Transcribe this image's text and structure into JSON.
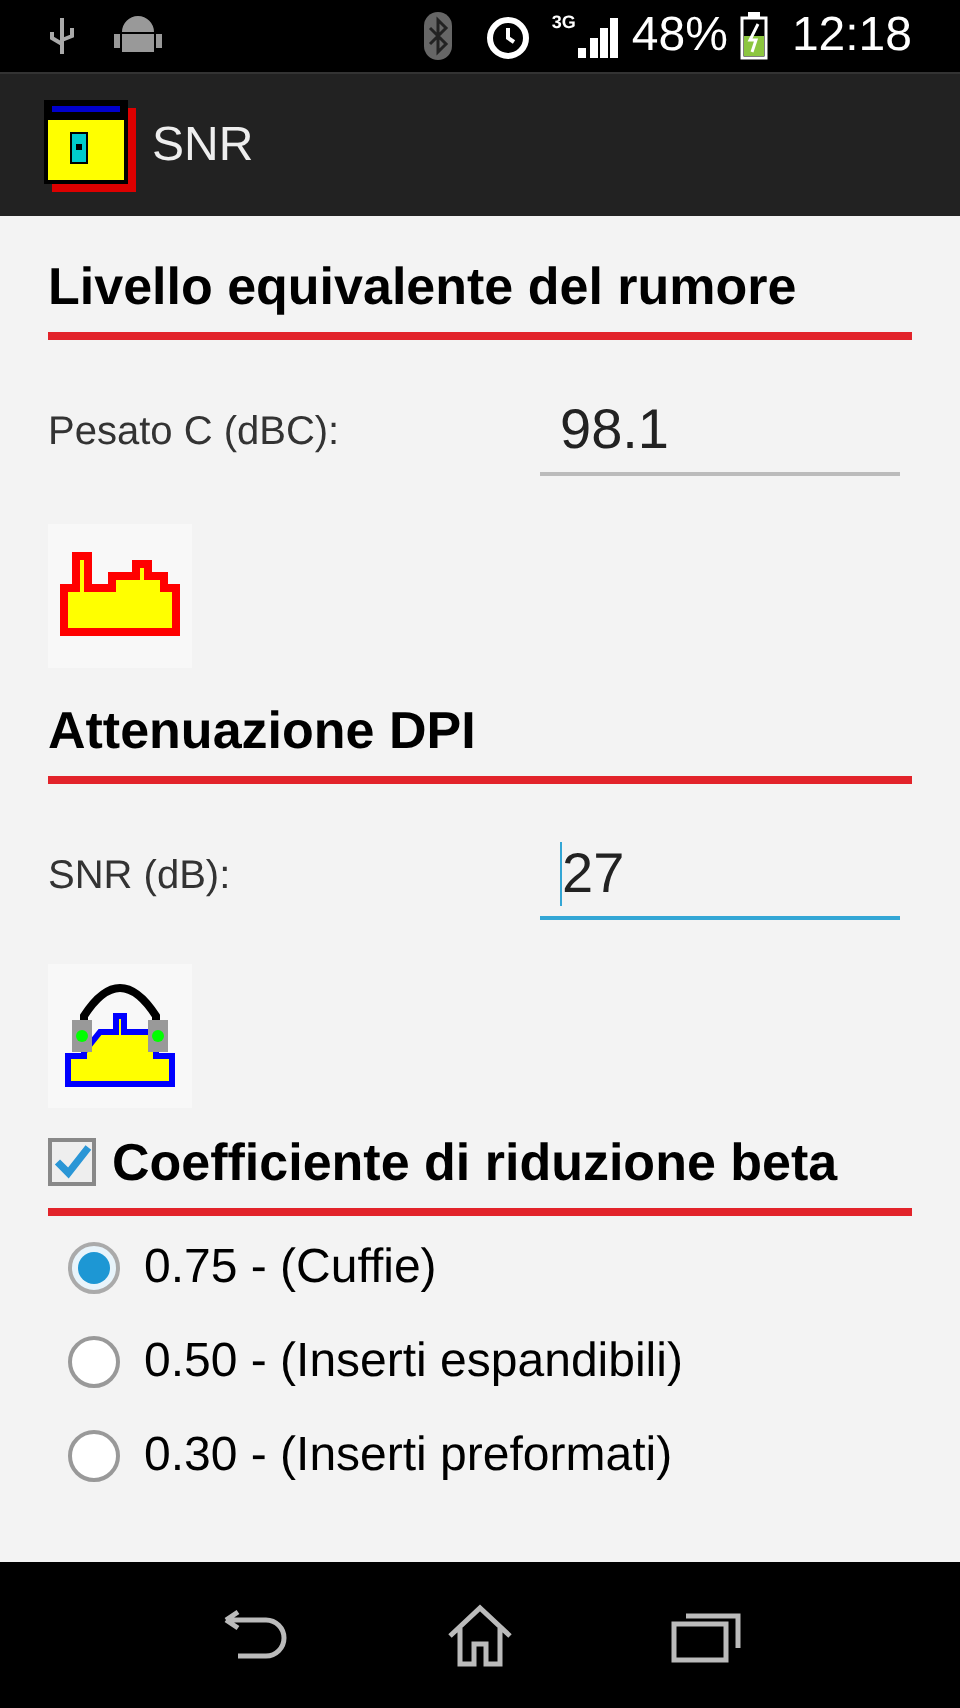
{
  "status_bar": {
    "network": "3G",
    "battery": "48%",
    "time": "12:18"
  },
  "app_bar": {
    "title": "SNR"
  },
  "sections": [
    {
      "kind": "field",
      "heading": "Livello equivalente del rumore",
      "label": "Pesato C (dBC):",
      "value": "98.1",
      "focused": false
    },
    {
      "kind": "field",
      "heading": "Attenuazione DPI",
      "label": "SNR (dB):",
      "value": "27",
      "focused": true
    },
    {
      "kind": "options",
      "heading": "Coefficiente di riduzione beta",
      "checked": true,
      "options": [
        {
          "label": "0.75 - (Cuffie)",
          "selected": true
        },
        {
          "label": "0.50 - (Inserti espandibili)",
          "selected": false
        },
        {
          "label": "0.30 - (Inserti preformati)",
          "selected": false
        }
      ]
    }
  ]
}
